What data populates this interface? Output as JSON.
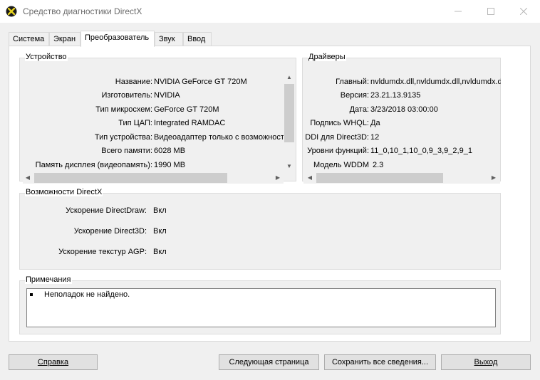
{
  "window": {
    "title": "Средство диагностики DirectX",
    "icon": "directx-icon"
  },
  "tabs": [
    {
      "label": "Система",
      "active": false
    },
    {
      "label": "Экран",
      "active": false
    },
    {
      "label": "Преобразователь",
      "active": true
    },
    {
      "label": "Звук",
      "active": false
    },
    {
      "label": "Ввод",
      "active": false
    }
  ],
  "device": {
    "title": "Устройство",
    "rows": [
      {
        "label": "Название:",
        "value": "NVIDIA GeForce GT 720M"
      },
      {
        "label": "Изготовитель:",
        "value": "NVIDIA"
      },
      {
        "label": "Тип микросхем:",
        "value": "GeForce GT 720M"
      },
      {
        "label": "Тип ЦАП:",
        "value": "Integrated RAMDAC"
      },
      {
        "label": "Тип устройства:",
        "value": "Видеоадаптер только с возможност"
      },
      {
        "label": "Всего памяти:",
        "value": "6028 MB"
      },
      {
        "label": "Память дисплея (видеопамять):",
        "value": "1990 MB"
      }
    ]
  },
  "drivers": {
    "title": "Драйверы",
    "rows": [
      {
        "label": "Главный:",
        "value": "nvldumdx.dll,nvldumdx.dll,nvldumdx.d"
      },
      {
        "label": "Версия:",
        "value": "23.21.13.9135"
      },
      {
        "label": "Дата:",
        "value": "3/23/2018 03:00:00"
      },
      {
        "label": "Подпись WHQL:",
        "value": "Да"
      },
      {
        "label": "DDI для Direct3D:",
        "value": "12"
      },
      {
        "label": "Уровни функций:",
        "value": "11_0,10_1,10_0,9_3,9_2,9_1"
      },
      {
        "label": "Модель WDDM",
        "value": "2.3"
      }
    ]
  },
  "directx": {
    "title": "Возможности DirectX",
    "rows": [
      {
        "label": "Ускорение DirectDraw:",
        "value": "Вкл"
      },
      {
        "label": "Ускорение Direct3D:",
        "value": "Вкл"
      },
      {
        "label": "Ускорение текстур AGP:",
        "value": "Вкл"
      }
    ]
  },
  "notes": {
    "title": "Примечания",
    "items": [
      "Неполадок не найдено."
    ]
  },
  "buttons": {
    "help": "Справка",
    "next": "Следующая страница",
    "save": "Сохранить все сведения...",
    "exit": "Выход"
  }
}
